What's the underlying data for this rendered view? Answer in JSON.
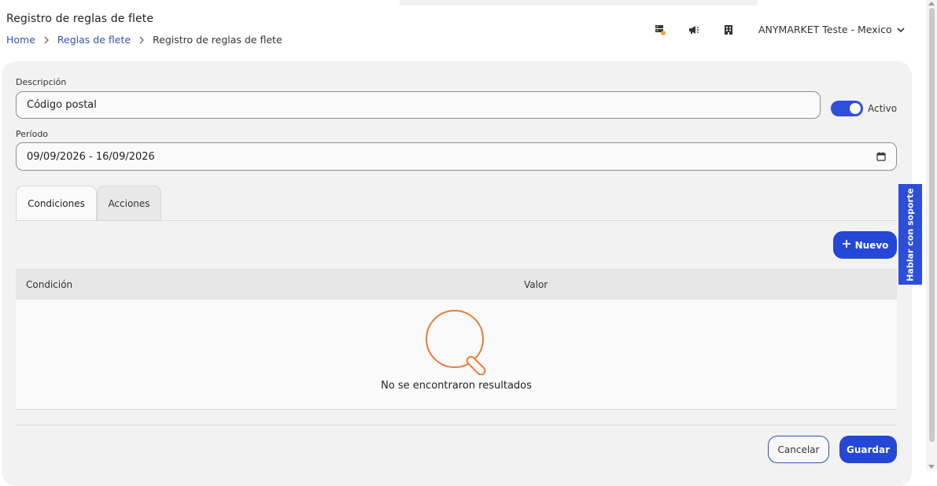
{
  "header": {
    "title": "Registro de reglas de flete",
    "breadcrumb": {
      "home": "Home",
      "parent": "Reglas de flete",
      "current": "Registro de reglas de flete"
    },
    "icons": [
      "server-notification-icon",
      "megaphone-icon",
      "building-icon"
    ],
    "account_name": "ANYMARKET Teste - Mexico"
  },
  "form": {
    "description_label": "Descripción",
    "description_value": "Código postal",
    "active_label": "Activo",
    "active": true,
    "period_label": "Período",
    "period_value": "09/09/2026 - 16/09/2026"
  },
  "tabs": [
    {
      "label": "Condiciones",
      "active": true
    },
    {
      "label": "Acciones",
      "active": false
    }
  ],
  "table": {
    "new_button": "Nuevo",
    "columns": [
      "Condición",
      "Valor"
    ],
    "empty_message": "No se encontraron resultados"
  },
  "footer": {
    "cancel": "Cancelar",
    "save": "Guardar"
  },
  "support_tab": "Hablar con soporte",
  "colors": {
    "primary": "#2447d6",
    "link": "#2f54b5",
    "empty_icon": "#ec7a34"
  }
}
